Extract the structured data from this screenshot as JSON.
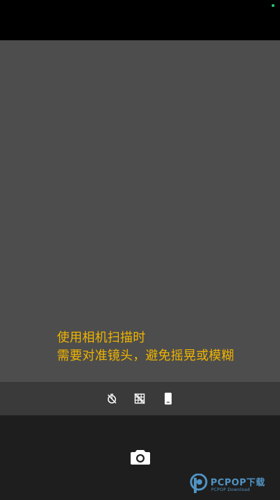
{
  "colors": {
    "top_bar": "#000000",
    "viewfinder": "#4d4d4d",
    "toolbar": "#3a3a3a",
    "bottom_bar": "#1e1e1e",
    "hint_text": "#f0b400",
    "icon": "#ffffff",
    "status_dot": "#2ecc71",
    "watermark": "#5aa8e0"
  },
  "hint": {
    "line1": "使用相机扫描时",
    "line2": "需要对准镜头，避免摇晃或模糊"
  },
  "toolbar": {
    "icons": [
      "timer-off-icon",
      "grid-off-icon",
      "phone-orientation-icon"
    ]
  },
  "shutter": {
    "icon": "camera-icon"
  },
  "watermark": {
    "text": "PCPOP下载",
    "subtext": "PCPOP Download"
  }
}
